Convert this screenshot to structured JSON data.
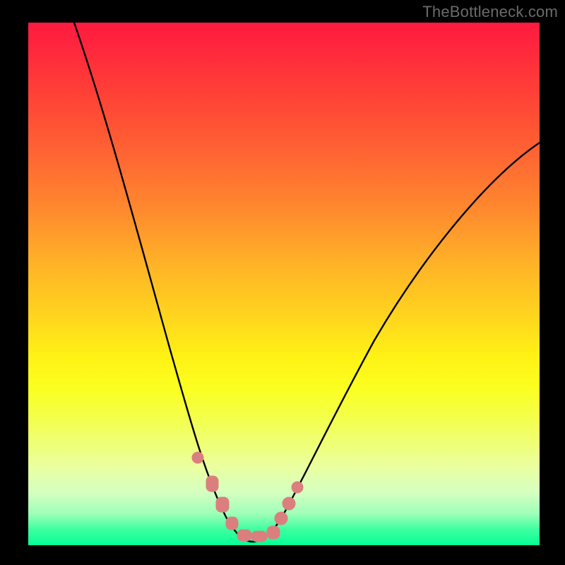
{
  "watermark": "TheBottleneck.com",
  "colors": {
    "background": "#000000",
    "curve_stroke": "#000000",
    "marker_fill": "#db7f7e",
    "gradient_top": "#ff1a3f",
    "gradient_bottom": "#06ff96"
  },
  "chart_data": {
    "type": "line",
    "title": "",
    "xlabel": "",
    "ylabel": "",
    "xlim": [
      0,
      100
    ],
    "ylim": [
      0,
      100
    ],
    "series": [
      {
        "name": "bottleneck-curve",
        "x": [
          9,
          12,
          15,
          18,
          21,
          24,
          27,
          30,
          32,
          34,
          36,
          38,
          39.5,
          41,
          42.5,
          44,
          46,
          48,
          51,
          54,
          58,
          62,
          67,
          72,
          78,
          85,
          92,
          100
        ],
        "values": [
          100,
          91,
          81,
          71,
          61,
          51,
          41,
          31,
          24,
          18,
          12,
          7,
          4,
          2,
          1,
          1,
          3,
          6,
          11,
          17,
          24,
          31,
          38,
          45,
          52,
          59,
          65,
          72
        ]
      }
    ],
    "markers": {
      "name": "highlighted-points",
      "x": [
        33.5,
        36,
        38,
        40,
        42,
        44,
        46,
        48,
        49.5,
        51
      ],
      "values": [
        16,
        10,
        6,
        3,
        1,
        1,
        3,
        6,
        9,
        12
      ]
    },
    "annotations": []
  }
}
